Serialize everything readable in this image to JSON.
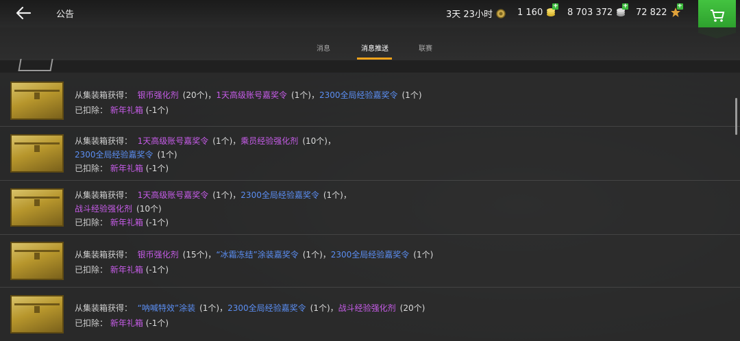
{
  "header": {
    "title": "公告",
    "timer": "3天 23小时",
    "gold": "1 160",
    "silver": "8 703 372",
    "xp": "72 822"
  },
  "tabs": [
    {
      "label": "消息"
    },
    {
      "label": "消息推送"
    },
    {
      "label": "联赛"
    }
  ],
  "messages": [
    {
      "get_label": "从集装箱获得：",
      "line1": [
        {
          "text": "银币强化剂",
          "color": "purple"
        },
        {
          "text": "(20个)，",
          "color": "plain"
        },
        {
          "text": "1天高级账号嘉奖令",
          "color": "purple"
        },
        {
          "text": "(1个)，",
          "color": "plain"
        },
        {
          "text": "2300全局经验嘉奖令",
          "color": "blue"
        },
        {
          "text": "(1个)",
          "color": "plain"
        }
      ],
      "line2": [],
      "removed_label": "已扣除：",
      "removed_item": "新年礼箱",
      "removed_count": "(-1个)"
    },
    {
      "get_label": "从集装箱获得：",
      "line1": [
        {
          "text": "1天高级账号嘉奖令",
          "color": "purple"
        },
        {
          "text": "(1个)，",
          "color": "plain"
        },
        {
          "text": "乘员经验强化剂",
          "color": "purple"
        },
        {
          "text": "(10个)，",
          "color": "plain"
        }
      ],
      "line2": [
        {
          "text": "2300全局经验嘉奖令",
          "color": "blue"
        },
        {
          "text": "(1个)",
          "color": "plain"
        }
      ],
      "removed_label": "已扣除：",
      "removed_item": "新年礼箱",
      "removed_count": "(-1个)"
    },
    {
      "get_label": "从集装箱获得：",
      "line1": [
        {
          "text": "1天高级账号嘉奖令",
          "color": "purple"
        },
        {
          "text": "(1个)，",
          "color": "plain"
        },
        {
          "text": "2300全局经验嘉奖令",
          "color": "blue"
        },
        {
          "text": "(1个)，",
          "color": "plain"
        }
      ],
      "line2": [
        {
          "text": "战斗经验强化剂",
          "color": "purple"
        },
        {
          "text": "(10个)",
          "color": "plain"
        }
      ],
      "removed_label": "已扣除：",
      "removed_item": "新年礼箱",
      "removed_count": "(-1个)"
    },
    {
      "get_label": "从集装箱获得：",
      "line1": [
        {
          "text": "银币强化剂",
          "color": "purple"
        },
        {
          "text": "(15个)，",
          "color": "plain"
        },
        {
          "text": "“冰霜冻结”涂装嘉奖令",
          "color": "blue"
        },
        {
          "text": "(1个)，",
          "color": "plain"
        },
        {
          "text": "2300全局经验嘉奖令",
          "color": "blue"
        },
        {
          "text": "(1个)",
          "color": "plain"
        }
      ],
      "line2": [],
      "removed_label": "已扣除：",
      "removed_item": "新年礼箱",
      "removed_count": "(-1个)"
    },
    {
      "get_label": "从集装箱获得：",
      "line1": [
        {
          "text": "“呐喊特效”涂装",
          "color": "blue"
        },
        {
          "text": "(1个)，",
          "color": "plain"
        },
        {
          "text": "2300全局经验嘉奖令",
          "color": "blue"
        },
        {
          "text": "(1个)，",
          "color": "plain"
        },
        {
          "text": "战斗经验强化剂",
          "color": "purple"
        },
        {
          "text": "(20个)",
          "color": "plain"
        }
      ],
      "line2": [],
      "removed_label": "已扣除：",
      "removed_item": "新年礼箱",
      "removed_count": "(-1个)"
    }
  ]
}
